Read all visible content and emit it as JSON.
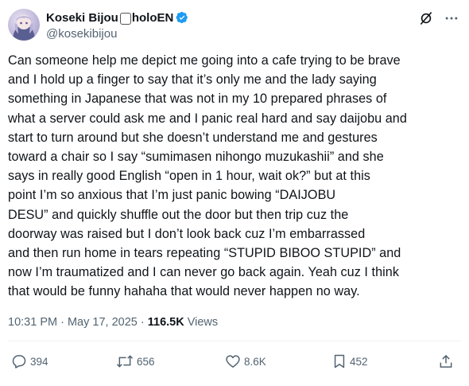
{
  "author": {
    "display_name": "Koseki Bijou",
    "display_name_suffix": "holoEN",
    "handle": "@kosekibijou",
    "verified_color": "#1d9bf0"
  },
  "tweet": {
    "text": "Can someone help me depict me going into a cafe trying to be brave\nand I hold up a finger to say that it’s only me and the lady saying\nsomething in Japanese that was not in my 10 prepared phrases of\nwhat a server could ask me and I panic real hard and say daijobu and\nstart to turn around but she doesn’t understand me and gestures\ntoward a chair so I say “sumimasen nihongo muzukashii” and she\nsays in really good English “open in 1 hour, wait ok?” but at this\npoint I’m so anxious that I’m just panic bowing “DAIJOBU\nDESU” and quickly shuffle out the door but then trip cuz the\ndoorway was raised but I don’t look back cuz I’m embarrassed\nand then run home in tears repeating “STUPID BIBOO STUPID” and\nnow I’m traumatized and I can never go back again. Yeah cuz I think\nthat would be funny hahaha that would never happen no way.",
    "time": "10:31 PM",
    "date": "May 17, 2025",
    "separator": " · ",
    "views_count": "116.5K",
    "views_label": "Views"
  },
  "actions": {
    "replies": "394",
    "reposts": "656",
    "likes": "8.6K",
    "bookmarks": "452"
  },
  "icons": {
    "grok": "grok-icon",
    "more": "more-icon",
    "reply": "reply-icon",
    "repost": "repost-icon",
    "like": "like-icon",
    "bookmark": "bookmark-icon",
    "share": "share-icon",
    "verified": "verified-badge-icon"
  }
}
